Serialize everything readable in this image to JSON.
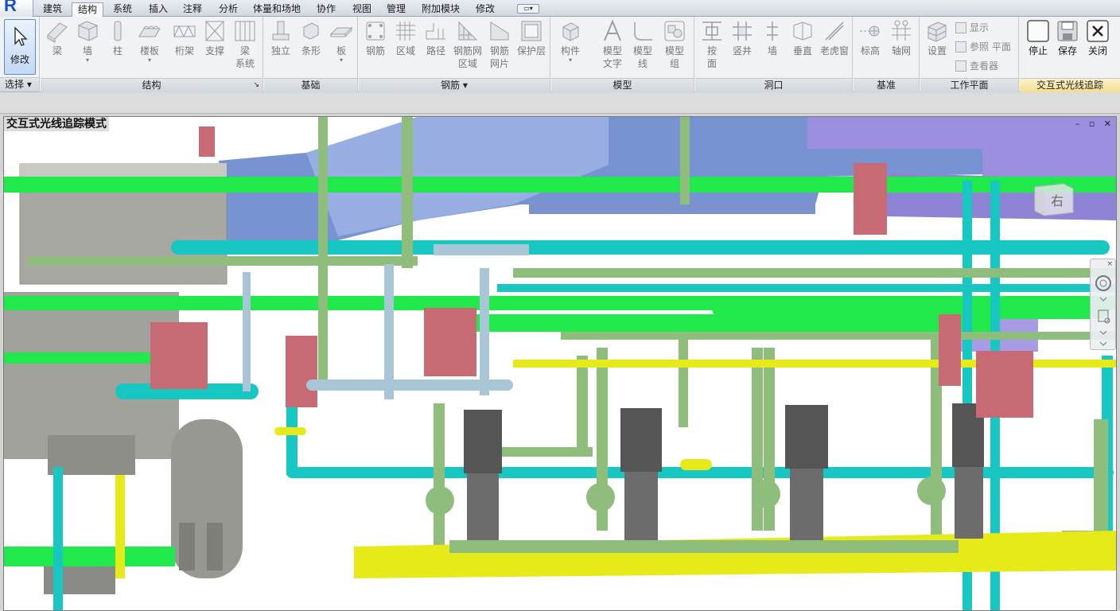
{
  "app": {
    "logo_letter": "R"
  },
  "tabs": [
    {
      "label": "建筑",
      "active": false
    },
    {
      "label": "结构",
      "active": true
    },
    {
      "label": "系统",
      "active": false
    },
    {
      "label": "插入",
      "active": false
    },
    {
      "label": "注释",
      "active": false
    },
    {
      "label": "分析",
      "active": false
    },
    {
      "label": "体量和场地",
      "active": false
    },
    {
      "label": "协作",
      "active": false
    },
    {
      "label": "视图",
      "active": false
    },
    {
      "label": "管理",
      "active": false
    },
    {
      "label": "附加模块",
      "active": false
    },
    {
      "label": "修改",
      "active": false
    }
  ],
  "tab_dropdown_glyph": "▭▾",
  "ribbon": {
    "select": {
      "modify_label": "修改",
      "panel_label": "选择 ▾"
    },
    "structure": {
      "title": "结构",
      "buttons": [
        "梁",
        "墙",
        "柱",
        "楼板",
        "桁架",
        "支撑",
        "梁\n系统"
      ]
    },
    "foundation": {
      "title": "基础",
      "buttons": [
        "独立",
        "条形",
        "板"
      ]
    },
    "rebar": {
      "title": "钢筋 ▾",
      "buttons": [
        "钢筋",
        "区域",
        "路径",
        "钢筋网\n区域",
        "钢筋\n网片",
        "保护层"
      ]
    },
    "model": {
      "title": "模型",
      "buttons": [
        "构件",
        "模型\n文字",
        "模型\n线",
        "模型\n组"
      ]
    },
    "opening": {
      "title": "洞口",
      "buttons": [
        "按\n面",
        "竖井",
        "墙",
        "垂直",
        "老虎窗"
      ]
    },
    "datum": {
      "title": "基准",
      "buttons": [
        "标高",
        "轴网"
      ]
    },
    "workplane": {
      "title": "工作平面",
      "set_label": "设置",
      "small": [
        "显示",
        "参照 平面",
        "查看器"
      ]
    },
    "raytrace": {
      "title": "交互式光线追踪",
      "buttons": [
        "停止",
        "保存",
        "关闭"
      ]
    }
  },
  "viewport": {
    "title": "交互式光线追踪模式",
    "window_controls": "– ▫ ✕",
    "viewcube_face": "右"
  },
  "colors": {
    "accent_tab": "#f7f8fa",
    "highlight_panel": "#f2dd92",
    "pipe_green": "#8fbe7c",
    "pipe_teal": "#19c7c2",
    "pipe_bright_green": "#21e84b",
    "pipe_yellow": "#e6ea18",
    "duct_blue": "#6e8fd0",
    "duct_purple": "#9c8fe0",
    "equipment_red": "#c86a73",
    "tank_gray": "#a6a6a0"
  }
}
